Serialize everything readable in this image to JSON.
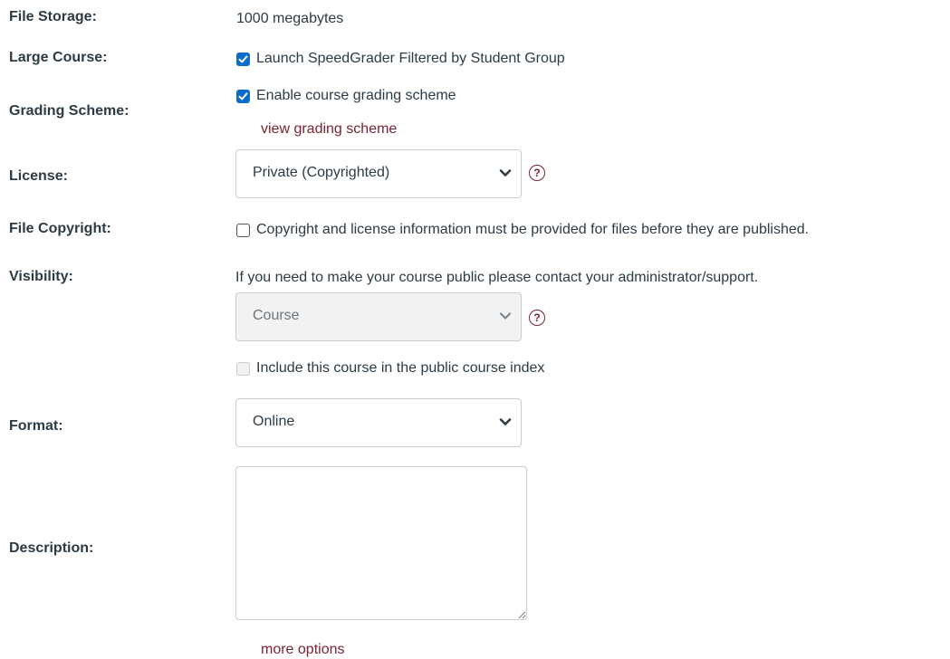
{
  "file_storage": {
    "label": "File Storage:",
    "value": "1000 megabytes"
  },
  "large_course": {
    "label": "Large Course:",
    "checkbox_label": "Launch SpeedGrader Filtered by Student Group",
    "checked": true
  },
  "grading_scheme": {
    "label": "Grading Scheme:",
    "checkbox_label": "Enable course grading scheme",
    "checked": true,
    "link": "view grading scheme"
  },
  "license": {
    "label": "License:",
    "selected": "Private (Copyrighted)",
    "help_icon": "question-circle-icon"
  },
  "file_copyright": {
    "label": "File Copyright:",
    "checkbox_label": "Copyright and license information must be provided for files before they are published.",
    "checked": false
  },
  "visibility": {
    "label": "Visibility:",
    "notice": "If you need to make your course public please contact your administrator/support.",
    "selected": "Course",
    "disabled": true,
    "help_icon": "question-circle-icon",
    "public_index_label": "Include this course in the public course index",
    "public_index_checked": false
  },
  "format": {
    "label": "Format:",
    "selected": "Online"
  },
  "description": {
    "label": "Description:",
    "value": ""
  },
  "more_options": "more options",
  "colors": {
    "link": "#7b2330",
    "checkbox_checked": "#0b6ccb",
    "text": "#2d3b45"
  }
}
